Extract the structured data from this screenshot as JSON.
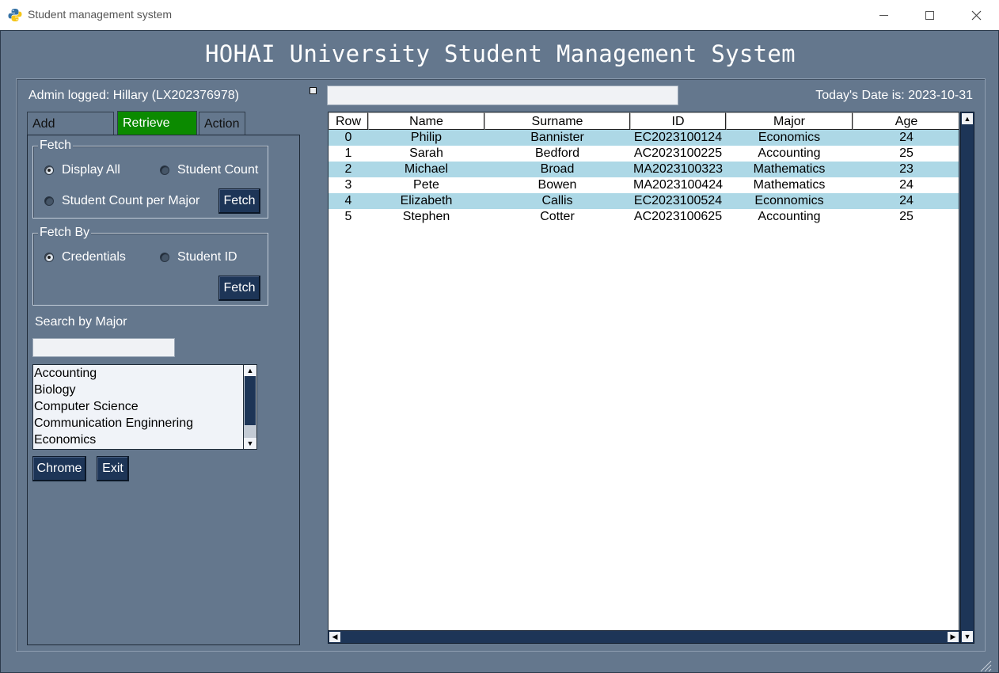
{
  "window": {
    "title": "Student management system",
    "minimize": "—",
    "close": "✕"
  },
  "app": {
    "heading": "HOHAI University Student Management System",
    "admin_label": "Admin logged: Hillary (LX202376978)",
    "date_label": "Today's Date is: 2023-10-31"
  },
  "tabs": [
    {
      "label": "Add Students",
      "selected": false
    },
    {
      "label": "Retrieve Info",
      "selected": true
    },
    {
      "label": "Action",
      "selected": false
    }
  ],
  "fetch_group": {
    "legend": "Fetch",
    "options": [
      {
        "label": "Display All",
        "selected": true
      },
      {
        "label": "Student Count",
        "selected": false
      },
      {
        "label": "Student Count per Major",
        "selected": false
      }
    ],
    "button": "Fetch"
  },
  "fetch_by_group": {
    "legend": "Fetch By",
    "options": [
      {
        "label": "Credentials",
        "selected": true
      },
      {
        "label": "Student ID",
        "selected": false
      }
    ],
    "button": "Fetch"
  },
  "search": {
    "label": "Search by Major",
    "value": "",
    "majors": [
      "Accounting",
      "Biology",
      "Computer Science",
      "Communication Enginnering",
      "Economics"
    ]
  },
  "buttons": {
    "chrome": "Chrome",
    "exit": "Exit"
  },
  "top_input": {
    "value": ""
  },
  "table": {
    "columns": [
      "Row",
      "Name",
      "Surname",
      "ID",
      "Major",
      "Age"
    ],
    "rows": [
      [
        "0",
        "Philip",
        "Bannister",
        "EC2023100124",
        "Economics",
        "24"
      ],
      [
        "1",
        "Sarah",
        "Bedford",
        "AC2023100225",
        "Accounting",
        "25"
      ],
      [
        "2",
        "Michael",
        "Broad",
        "MA2023100323",
        "Mathematics",
        "23"
      ],
      [
        "3",
        "Pete",
        "Bowen",
        "MA2023100424",
        "Mathematics",
        "24"
      ],
      [
        "4",
        "Elizabeth",
        "Callis",
        "EC2023100524",
        "Econnomics",
        "24"
      ],
      [
        "5",
        "Stephen",
        "Cotter",
        "AC2023100625",
        "Accounting",
        "25"
      ]
    ]
  },
  "colors": {
    "background": "#64778d",
    "selected_tab": "#0b8a00",
    "button": "#1d3557",
    "row_highlight": "#add8e6"
  }
}
